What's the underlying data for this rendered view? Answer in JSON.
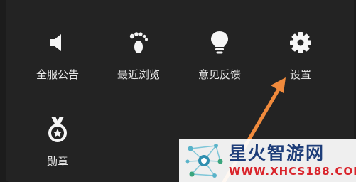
{
  "menu": {
    "items": [
      {
        "label": "全服公告",
        "icon": "speaker-icon"
      },
      {
        "label": "最近浏览",
        "icon": "footprint-icon"
      },
      {
        "label": "意见反馈",
        "icon": "lightbulb-icon"
      },
      {
        "label": "设置",
        "icon": "gear-icon"
      },
      {
        "label": "勋章",
        "icon": "medal-icon"
      }
    ]
  },
  "watermark": {
    "title": "星火智游网",
    "url": "WWW.XHCS188.COM"
  },
  "colors": {
    "background": "#1c1c1c",
    "icon": "#f5f5f5",
    "label": "#e8e8e8",
    "arrow": "#f08a3c",
    "watermark_title": "#1e3e7a",
    "watermark_url": "#d9242b"
  }
}
